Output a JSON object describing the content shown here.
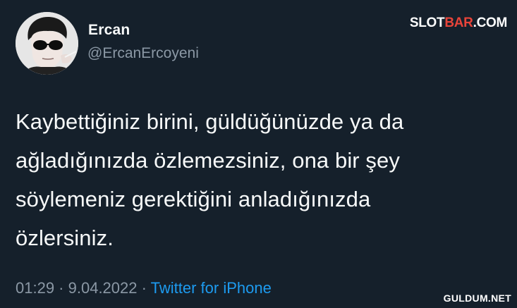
{
  "author": {
    "display_name": "Ercan",
    "handle": "@ErcanErcoyeni"
  },
  "tweet": {
    "lines": [
      "Kaybettiğiniz birini, güldüğünüzde ya da",
      "ağladığınızda özlemezsiniz, ona bir şey",
      "söylemeniz gerektiğini anladığınızda",
      "özlersiniz."
    ],
    "time": "01:29",
    "separator": " · ",
    "date": "9.04.2022",
    "source": "Twitter for iPhone"
  },
  "watermarks": {
    "top_part1": "SLOT",
    "top_part2": "BAR",
    "top_part3": ".COM",
    "bottom": "GULDUM.NET"
  },
  "colors": {
    "background": "#15202b",
    "text": "#f7f9f9",
    "secondary": "#8b98a5",
    "link": "#1d9bf0",
    "watermark_accent": "#e8443a"
  },
  "icons": {
    "avatar": "profile-photo-man-with-sunglasses"
  }
}
